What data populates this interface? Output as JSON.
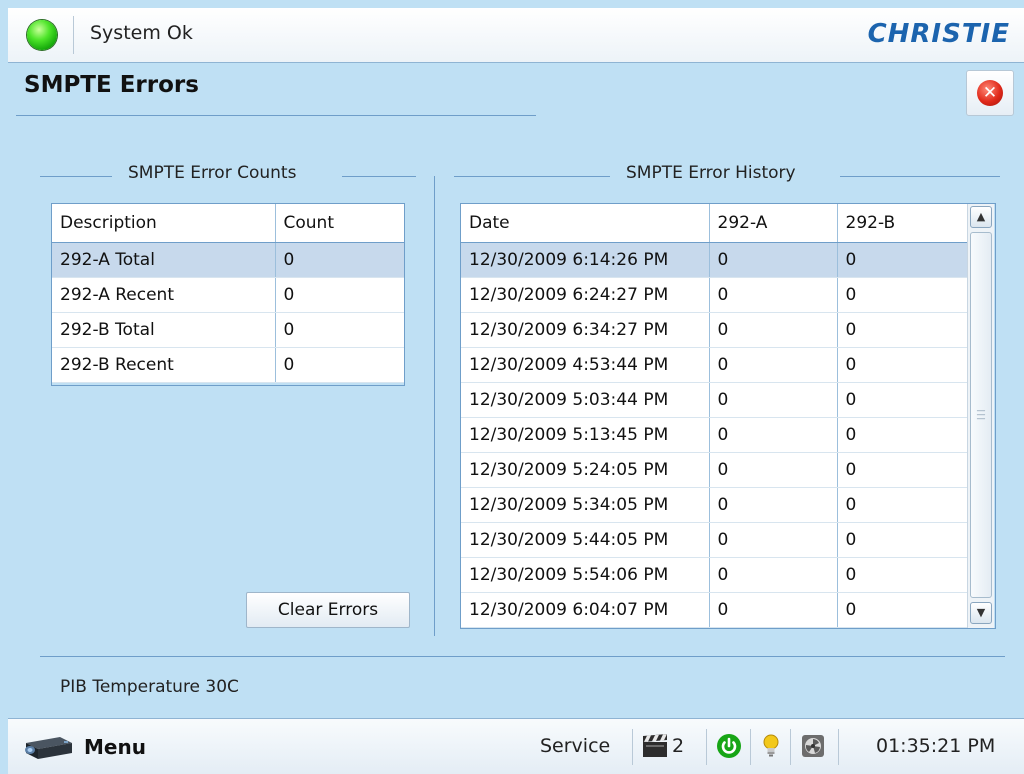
{
  "header": {
    "status_text": "System Ok",
    "status_color": "#2fcf1e",
    "brand": "CHRISTIE",
    "brand_color": "#1c64ae"
  },
  "page": {
    "title": "SMPTE Errors",
    "close_icon": "close-icon"
  },
  "counts": {
    "legend": "SMPTE Error Counts",
    "columns": [
      "Description",
      "Count"
    ],
    "rows": [
      {
        "description": "292-A Total",
        "count": "0"
      },
      {
        "description": "292-A Recent",
        "count": "0"
      },
      {
        "description": "292-B Total",
        "count": "0"
      },
      {
        "description": "292-B Recent",
        "count": "0"
      }
    ],
    "clear_button": "Clear Errors"
  },
  "history": {
    "legend": "SMPTE Error History",
    "columns": [
      "Date",
      "292-A",
      "292-B"
    ],
    "rows": [
      {
        "date": "12/30/2009 6:14:26 PM",
        "a": "0",
        "b": "0"
      },
      {
        "date": "12/30/2009 6:24:27 PM",
        "a": "0",
        "b": "0"
      },
      {
        "date": "12/30/2009 6:34:27 PM",
        "a": "0",
        "b": "0"
      },
      {
        "date": "12/30/2009 4:53:44 PM",
        "a": "0",
        "b": "0"
      },
      {
        "date": "12/30/2009 5:03:44 PM",
        "a": "0",
        "b": "0"
      },
      {
        "date": "12/30/2009 5:13:45 PM",
        "a": "0",
        "b": "0"
      },
      {
        "date": "12/30/2009 5:24:05 PM",
        "a": "0",
        "b": "0"
      },
      {
        "date": "12/30/2009 5:34:05 PM",
        "a": "0",
        "b": "0"
      },
      {
        "date": "12/30/2009 5:44:05 PM",
        "a": "0",
        "b": "0"
      },
      {
        "date": "12/30/2009 5:54:06 PM",
        "a": "0",
        "b": "0"
      },
      {
        "date": "12/30/2009 6:04:07 PM",
        "a": "0",
        "b": "0"
      }
    ]
  },
  "footer": {
    "pib_temperature": "PIB Temperature 30C"
  },
  "bottom_bar": {
    "menu_label": "Menu",
    "service_label": "Service",
    "clapper_count": "2",
    "time": "01:35:21 PM",
    "icons": [
      "projector-icon",
      "clapperboard-icon",
      "power-icon",
      "lamp-icon",
      "cooling-fan-icon"
    ]
  },
  "colors": {
    "background": "#bfe0f4",
    "accent_line": "#6f9ec9",
    "selected_row": "#c7d9ec",
    "power_green": "#17a516",
    "lamp_yellow": "#f2c81b"
  }
}
